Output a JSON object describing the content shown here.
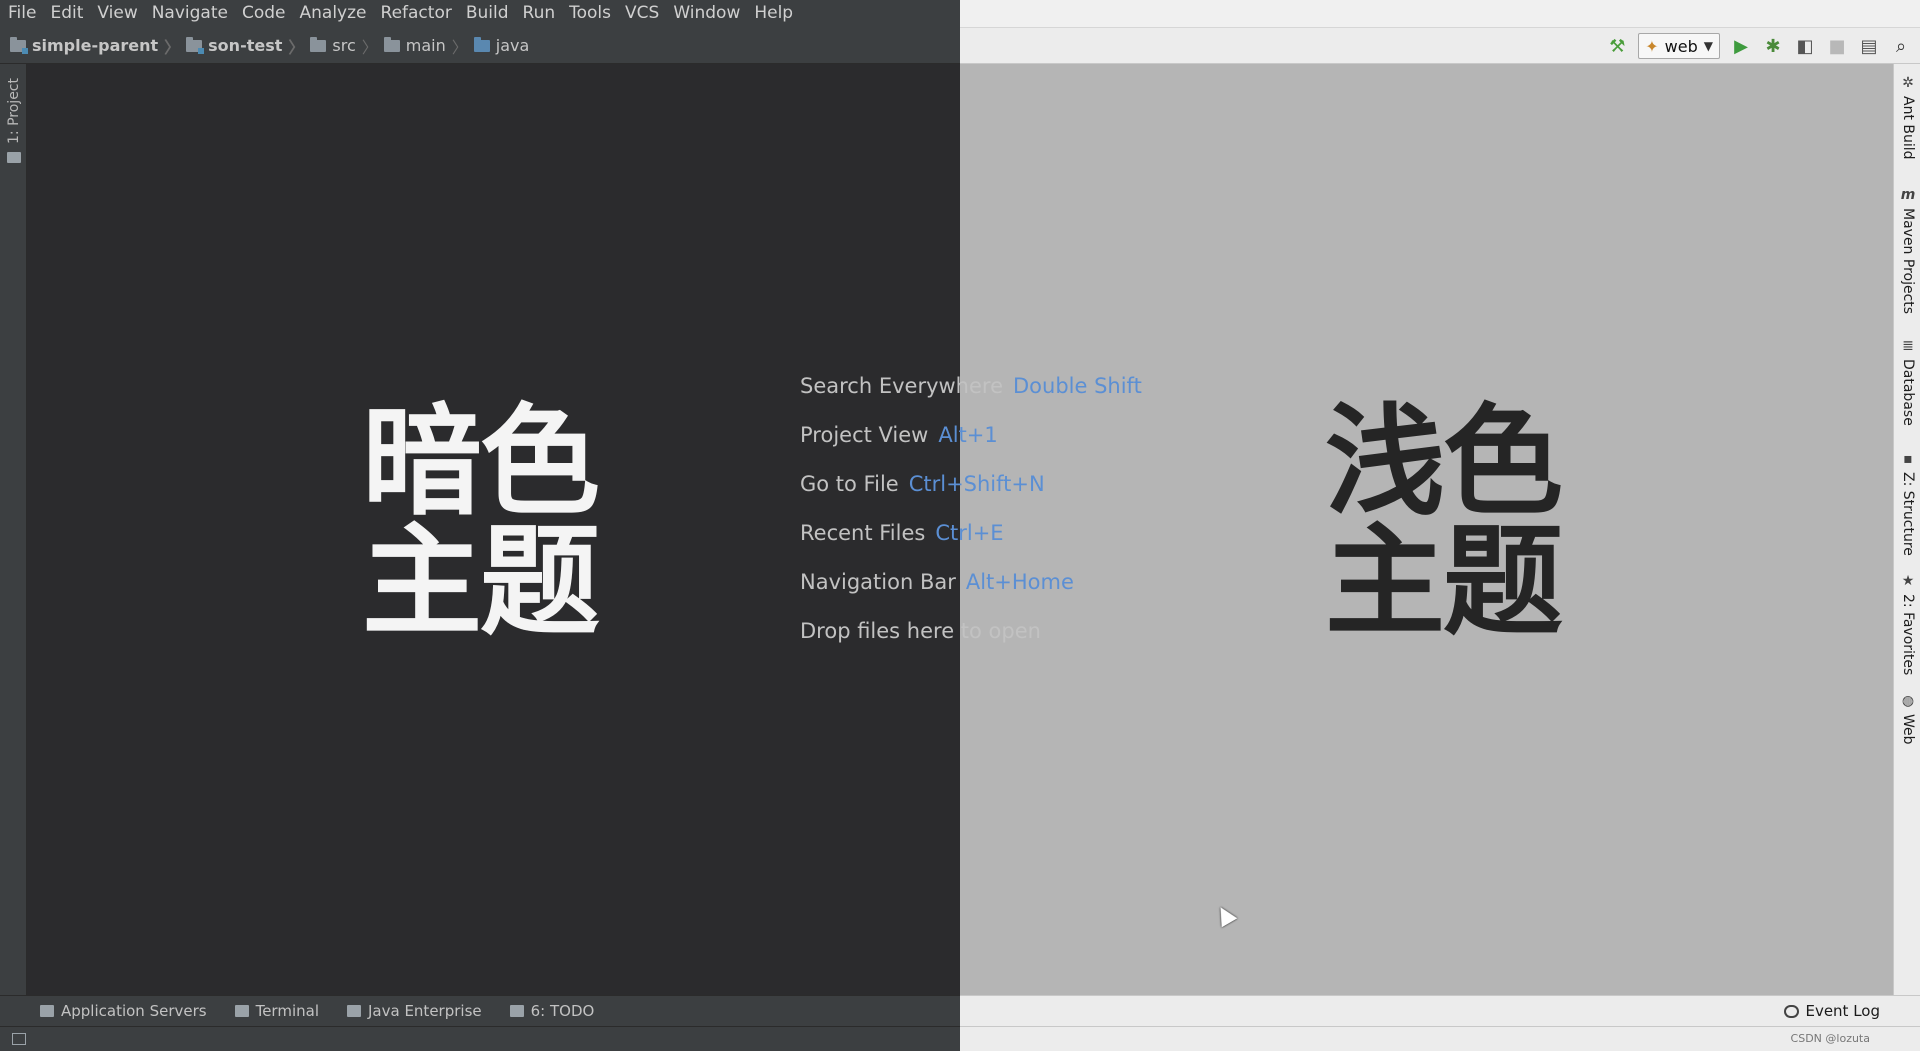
{
  "menu": [
    {
      "label": "File"
    },
    {
      "label": "Edit"
    },
    {
      "label": "View"
    },
    {
      "label": "Navigate"
    },
    {
      "label": "Code"
    },
    {
      "label": "Analyze"
    },
    {
      "label": "Refactor"
    },
    {
      "label": "Build"
    },
    {
      "label": "Run"
    },
    {
      "label": "Tools"
    },
    {
      "label": "VCS"
    },
    {
      "label": "Window"
    },
    {
      "label": "Help"
    }
  ],
  "breadcrumb": [
    "simple-parent",
    "son-test",
    "src",
    "main",
    "java"
  ],
  "toolbar": {
    "run_config": "web",
    "icons": [
      "build-hammer-icon",
      "run-icon",
      "debug-icon",
      "coverage-icon",
      "stop-icon",
      "project-structure-icon",
      "search-icon"
    ]
  },
  "left_tool_tabs": [
    "1: Project"
  ],
  "right_tool_tabs": [
    "Ant Build",
    "Maven Projects",
    "Database",
    "Z: Structure",
    "2: Favorites",
    "Web"
  ],
  "labels": {
    "dark_theme_line1": "暗色",
    "dark_theme_line2": "主题",
    "light_theme_line1": "浅色",
    "light_theme_line2": "主题"
  },
  "hints": [
    {
      "label": "Search Everywhere",
      "key": "Double Shift"
    },
    {
      "label": "Project View",
      "key": "Alt+1"
    },
    {
      "label": "Go to File",
      "key": "Ctrl+Shift+N"
    },
    {
      "label": "Recent Files",
      "key": "Ctrl+E"
    },
    {
      "label": "Navigation Bar",
      "key": "Alt+Home"
    },
    {
      "label": "Drop files here to open",
      "key": ""
    }
  ],
  "bottom_tabs": [
    "Application Servers",
    "Terminal",
    "Java Enterprise",
    "6: TODO"
  ],
  "event_log": "Event Log",
  "watermark": "CSDN @lozuta",
  "colors": {
    "dark_bg": "#2b2b2d",
    "light_bg": "#b5b5b5",
    "accent_blue": "#5b8fd4"
  }
}
